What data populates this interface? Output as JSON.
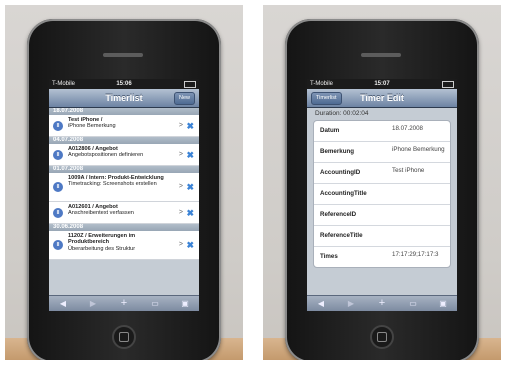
{
  "left": {
    "status": {
      "carrier": "T-Mobile",
      "time": "15:06"
    },
    "nav": {
      "title": "Timerlist",
      "new_label": "New"
    },
    "groups": [
      {
        "date": "18.07.2008",
        "items": [
          {
            "title": "Test iPhone /",
            "subtitle": "iPhone Bemerkung"
          }
        ]
      },
      {
        "date": "04.07.2008",
        "items": [
          {
            "title": "A012806 / Angebot",
            "subtitle": "Angebotspositionen definieren"
          }
        ]
      },
      {
        "date": "01.07.2008",
        "items": [
          {
            "title": "1009A / Intern: Produkt-Entwicklung",
            "subtitle": "Timetracking: Screenshots erstellen"
          },
          {
            "title": "A012601 / Angebot",
            "subtitle": "Anschreibentext verfassen"
          }
        ]
      },
      {
        "date": "30.06.2008",
        "items": [
          {
            "title": "1120Z / Erweiterungen im Produktbereich",
            "subtitle": "Überarbeitung des Struktur"
          }
        ]
      }
    ]
  },
  "right": {
    "status": {
      "carrier": "T-Mobile",
      "time": "15:07"
    },
    "nav": {
      "title": "Timer Edit",
      "back_label": "Timerlist"
    },
    "duration": "Duration: 00:02:04",
    "fields": [
      {
        "label": "Datum",
        "value": "18.07.2008"
      },
      {
        "label": "Bemerkung",
        "value": "iPhone Bemerkung"
      },
      {
        "label": "AccountingID",
        "value": "Test iPhone"
      },
      {
        "label": "AccountingTitle",
        "value": ""
      },
      {
        "label": "ReferenceID",
        "value": ""
      },
      {
        "label": "ReferenceTitle",
        "value": ""
      },
      {
        "label": "Times",
        "value": "17:17:29;17:17:3"
      }
    ]
  },
  "toolbar_icons": [
    "back-arrow-icon",
    "forward-arrow-icon",
    "plus-icon",
    "bookmarks-icon",
    "pages-icon"
  ]
}
